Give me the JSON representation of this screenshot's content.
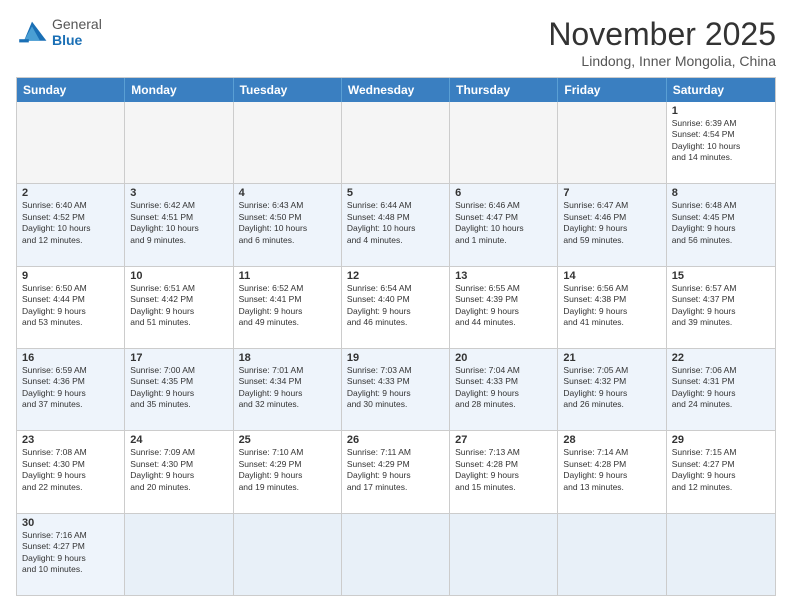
{
  "logo": {
    "text_general": "General",
    "text_blue": "Blue"
  },
  "title": "November 2025",
  "subtitle": "Lindong, Inner Mongolia, China",
  "day_headers": [
    "Sunday",
    "Monday",
    "Tuesday",
    "Wednesday",
    "Thursday",
    "Friday",
    "Saturday"
  ],
  "rows": [
    {
      "alt": false,
      "cells": [
        {
          "empty": true,
          "number": "",
          "info": ""
        },
        {
          "empty": true,
          "number": "",
          "info": ""
        },
        {
          "empty": true,
          "number": "",
          "info": ""
        },
        {
          "empty": true,
          "number": "",
          "info": ""
        },
        {
          "empty": true,
          "number": "",
          "info": ""
        },
        {
          "empty": true,
          "number": "",
          "info": ""
        },
        {
          "empty": false,
          "number": "1",
          "info": "Sunrise: 6:39 AM\nSunset: 4:54 PM\nDaylight: 10 hours\nand 14 minutes."
        }
      ]
    },
    {
      "alt": true,
      "cells": [
        {
          "empty": false,
          "number": "2",
          "info": "Sunrise: 6:40 AM\nSunset: 4:52 PM\nDaylight: 10 hours\nand 12 minutes."
        },
        {
          "empty": false,
          "number": "3",
          "info": "Sunrise: 6:42 AM\nSunset: 4:51 PM\nDaylight: 10 hours\nand 9 minutes."
        },
        {
          "empty": false,
          "number": "4",
          "info": "Sunrise: 6:43 AM\nSunset: 4:50 PM\nDaylight: 10 hours\nand 6 minutes."
        },
        {
          "empty": false,
          "number": "5",
          "info": "Sunrise: 6:44 AM\nSunset: 4:48 PM\nDaylight: 10 hours\nand 4 minutes."
        },
        {
          "empty": false,
          "number": "6",
          "info": "Sunrise: 6:46 AM\nSunset: 4:47 PM\nDaylight: 10 hours\nand 1 minute."
        },
        {
          "empty": false,
          "number": "7",
          "info": "Sunrise: 6:47 AM\nSunset: 4:46 PM\nDaylight: 9 hours\nand 59 minutes."
        },
        {
          "empty": false,
          "number": "8",
          "info": "Sunrise: 6:48 AM\nSunset: 4:45 PM\nDaylight: 9 hours\nand 56 minutes."
        }
      ]
    },
    {
      "alt": false,
      "cells": [
        {
          "empty": false,
          "number": "9",
          "info": "Sunrise: 6:50 AM\nSunset: 4:44 PM\nDaylight: 9 hours\nand 53 minutes."
        },
        {
          "empty": false,
          "number": "10",
          "info": "Sunrise: 6:51 AM\nSunset: 4:42 PM\nDaylight: 9 hours\nand 51 minutes."
        },
        {
          "empty": false,
          "number": "11",
          "info": "Sunrise: 6:52 AM\nSunset: 4:41 PM\nDaylight: 9 hours\nand 49 minutes."
        },
        {
          "empty": false,
          "number": "12",
          "info": "Sunrise: 6:54 AM\nSunset: 4:40 PM\nDaylight: 9 hours\nand 46 minutes."
        },
        {
          "empty": false,
          "number": "13",
          "info": "Sunrise: 6:55 AM\nSunset: 4:39 PM\nDaylight: 9 hours\nand 44 minutes."
        },
        {
          "empty": false,
          "number": "14",
          "info": "Sunrise: 6:56 AM\nSunset: 4:38 PM\nDaylight: 9 hours\nand 41 minutes."
        },
        {
          "empty": false,
          "number": "15",
          "info": "Sunrise: 6:57 AM\nSunset: 4:37 PM\nDaylight: 9 hours\nand 39 minutes."
        }
      ]
    },
    {
      "alt": true,
      "cells": [
        {
          "empty": false,
          "number": "16",
          "info": "Sunrise: 6:59 AM\nSunset: 4:36 PM\nDaylight: 9 hours\nand 37 minutes."
        },
        {
          "empty": false,
          "number": "17",
          "info": "Sunrise: 7:00 AM\nSunset: 4:35 PM\nDaylight: 9 hours\nand 35 minutes."
        },
        {
          "empty": false,
          "number": "18",
          "info": "Sunrise: 7:01 AM\nSunset: 4:34 PM\nDaylight: 9 hours\nand 32 minutes."
        },
        {
          "empty": false,
          "number": "19",
          "info": "Sunrise: 7:03 AM\nSunset: 4:33 PM\nDaylight: 9 hours\nand 30 minutes."
        },
        {
          "empty": false,
          "number": "20",
          "info": "Sunrise: 7:04 AM\nSunset: 4:33 PM\nDaylight: 9 hours\nand 28 minutes."
        },
        {
          "empty": false,
          "number": "21",
          "info": "Sunrise: 7:05 AM\nSunset: 4:32 PM\nDaylight: 9 hours\nand 26 minutes."
        },
        {
          "empty": false,
          "number": "22",
          "info": "Sunrise: 7:06 AM\nSunset: 4:31 PM\nDaylight: 9 hours\nand 24 minutes."
        }
      ]
    },
    {
      "alt": false,
      "cells": [
        {
          "empty": false,
          "number": "23",
          "info": "Sunrise: 7:08 AM\nSunset: 4:30 PM\nDaylight: 9 hours\nand 22 minutes."
        },
        {
          "empty": false,
          "number": "24",
          "info": "Sunrise: 7:09 AM\nSunset: 4:30 PM\nDaylight: 9 hours\nand 20 minutes."
        },
        {
          "empty": false,
          "number": "25",
          "info": "Sunrise: 7:10 AM\nSunset: 4:29 PM\nDaylight: 9 hours\nand 19 minutes."
        },
        {
          "empty": false,
          "number": "26",
          "info": "Sunrise: 7:11 AM\nSunset: 4:29 PM\nDaylight: 9 hours\nand 17 minutes."
        },
        {
          "empty": false,
          "number": "27",
          "info": "Sunrise: 7:13 AM\nSunset: 4:28 PM\nDaylight: 9 hours\nand 15 minutes."
        },
        {
          "empty": false,
          "number": "28",
          "info": "Sunrise: 7:14 AM\nSunset: 4:28 PM\nDaylight: 9 hours\nand 13 minutes."
        },
        {
          "empty": false,
          "number": "29",
          "info": "Sunrise: 7:15 AM\nSunset: 4:27 PM\nDaylight: 9 hours\nand 12 minutes."
        }
      ]
    },
    {
      "alt": true,
      "cells": [
        {
          "empty": false,
          "number": "30",
          "info": "Sunrise: 7:16 AM\nSunset: 4:27 PM\nDaylight: 9 hours\nand 10 minutes."
        },
        {
          "empty": true,
          "number": "",
          "info": ""
        },
        {
          "empty": true,
          "number": "",
          "info": ""
        },
        {
          "empty": true,
          "number": "",
          "info": ""
        },
        {
          "empty": true,
          "number": "",
          "info": ""
        },
        {
          "empty": true,
          "number": "",
          "info": ""
        },
        {
          "empty": true,
          "number": "",
          "info": ""
        }
      ]
    }
  ]
}
